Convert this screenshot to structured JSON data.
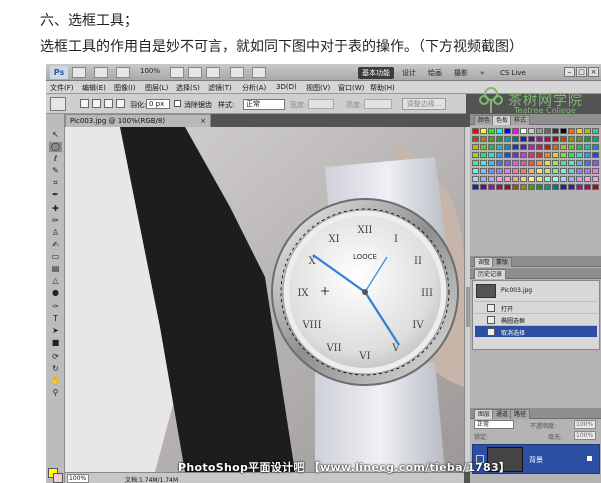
{
  "article": {
    "heading": "六、选框工具；",
    "intro": "选框工具的作用自是妙不可言，就如同下图中对于表的操作。（下方视频截图）"
  },
  "app": {
    "logo": "Ps",
    "zoom": "100%",
    "workspaces": [
      "基本功能",
      "设计",
      "绘画",
      "摄影"
    ],
    "more": "»",
    "cs_live": "CS Live",
    "menus": [
      "文件(F)",
      "编辑(E)",
      "图像(I)",
      "图层(L)",
      "选择(S)",
      "滤镜(T)",
      "分析(A)",
      "3D(D)",
      "视图(V)",
      "窗口(W)",
      "帮助(H)"
    ]
  },
  "options": {
    "feather_label": "羽化:",
    "feather_value": "0 px",
    "antialias_label": "消除锯齿",
    "style_label": "样式:",
    "style_value": "正常",
    "width_label": "宽度:",
    "height_label": "高度:",
    "refine_button": "调整边缘..."
  },
  "watermark": {
    "college_cn": "茶树网学院",
    "college_en": "Teatree College",
    "footer": "PhotoShop平面设计吧 【www.linecg.com/tieba/1783】"
  },
  "document": {
    "tab_title": "Pic003.jpg @ 100%(RGB/8)",
    "close": "×",
    "status_zoom": "100%",
    "status_doc": "文档:1.74M/1.74M"
  },
  "canvas": {
    "dial_brand": "LOOCE"
  },
  "panels": {
    "color_tabs": [
      "颜色",
      "色板",
      "样式"
    ],
    "swatch_colors": [
      "#ff0000",
      "#ffff00",
      "#00ff00",
      "#00ffff",
      "#0000ff",
      "#ff00ff",
      "#ffffff",
      "#cccccc",
      "#999999",
      "#666666",
      "#333333",
      "#000000",
      "#ff6600",
      "#ffcc00",
      "#99cc00",
      "#33cc99"
    ],
    "adjust_tabs": [
      "调整",
      "蒙版"
    ],
    "history_tabs": [
      "历史记录"
    ],
    "history": {
      "snapshot": "Pic003.jpg",
      "items": [
        "打开",
        "椭圆选框",
        "取消选择"
      ]
    },
    "layers_tabs": [
      "图层",
      "通道",
      "路径"
    ],
    "blend_mode": "正常",
    "opacity_label": "不透明度:",
    "opacity_value": "100%",
    "lock_label": "锁定:",
    "fill_label": "填充:",
    "fill_value": "100%",
    "layer_name": "背景"
  }
}
